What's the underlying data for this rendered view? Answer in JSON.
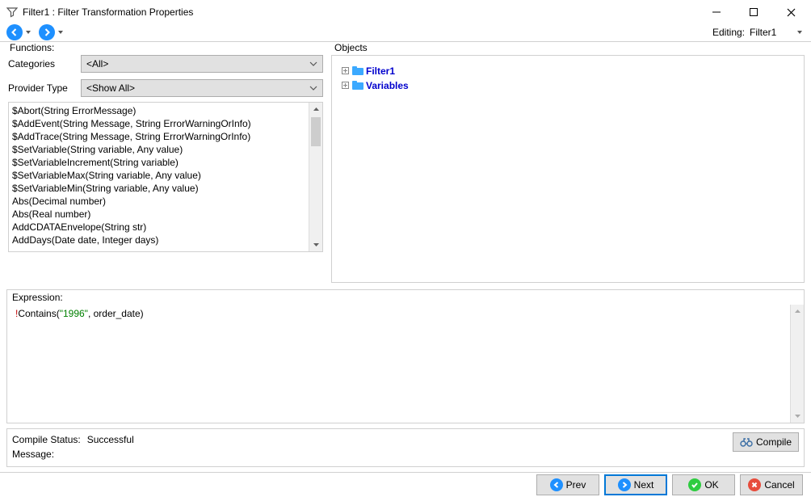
{
  "window": {
    "title": "Filter1 : Filter Transformation Properties"
  },
  "toolbar": {
    "editing_label": "Editing:",
    "editing_value": "Filter1"
  },
  "functions": {
    "label": "Functions:",
    "categories_label": "Categories",
    "categories_value": "<All>",
    "provider_label": "Provider Type",
    "provider_value": "<Show All>",
    "list": [
      "$Abort(String ErrorMessage)",
      "$AddEvent(String Message, String ErrorWarningOrInfo)",
      "$AddTrace(String Message, String ErrorWarningOrInfo)",
      "$SetVariable(String variable, Any value)",
      "$SetVariableIncrement(String variable)",
      "$SetVariableMax(String variable, Any value)",
      "$SetVariableMin(String variable, Any value)",
      "Abs(Decimal number)",
      "Abs(Real number)",
      "AddCDATAEnvelope(String str)",
      "AddDays(Date date, Integer days)"
    ]
  },
  "objects": {
    "label": "Objects",
    "nodes": [
      {
        "label": "Filter1"
      },
      {
        "label": "Variables"
      }
    ]
  },
  "expression": {
    "label": "Expression:",
    "op": "!",
    "fn": "Contains",
    "lparen": "(",
    "str": "\"1996\"",
    "comma": ", ",
    "id": "order_date",
    "rparen": ")"
  },
  "status": {
    "compile_label": "Compile Status:",
    "compile_value": "Successful",
    "message_label": "Message:",
    "compile_btn": "Compile"
  },
  "buttons": {
    "prev": "Prev",
    "next": "Next",
    "ok": "OK",
    "cancel": "Cancel"
  }
}
